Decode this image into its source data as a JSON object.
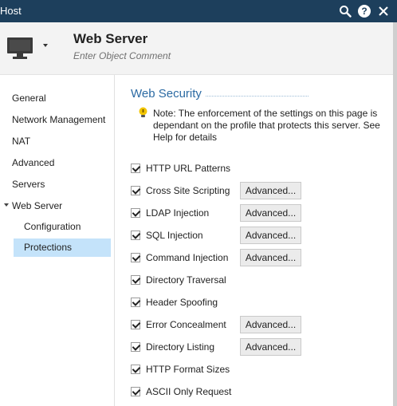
{
  "titlebar": {
    "title": "Host",
    "search_icon": "search-icon",
    "help_icon": "help-icon",
    "help_glyph": "?",
    "close_glyph": "✕"
  },
  "header": {
    "object_name": "Web Server",
    "comment_placeholder": "Enter Object Comment"
  },
  "sidebar": {
    "items": [
      {
        "label": "General"
      },
      {
        "label": "Network Management"
      },
      {
        "label": "NAT"
      },
      {
        "label": "Advanced"
      },
      {
        "label": "Servers"
      },
      {
        "label": "Web Server"
      },
      {
        "label": "Configuration"
      },
      {
        "label": "Protections"
      }
    ],
    "selected": "Protections",
    "expanded": "Web Server"
  },
  "main": {
    "section_title": "Web Security",
    "note": "Note: The enforcement of the settings on this page is dependant on the profile that protects this server. See Help for details",
    "advanced_label": "Advanced...",
    "protections": [
      {
        "label": "HTTP URL Patterns",
        "checked": true,
        "has_advanced": false
      },
      {
        "label": "Cross Site Scripting",
        "checked": true,
        "has_advanced": true
      },
      {
        "label": "LDAP Injection",
        "checked": true,
        "has_advanced": true
      },
      {
        "label": "SQL Injection",
        "checked": true,
        "has_advanced": true
      },
      {
        "label": "Command Injection",
        "checked": true,
        "has_advanced": true
      },
      {
        "label": "Directory Traversal",
        "checked": true,
        "has_advanced": false
      },
      {
        "label": "Header Spoofing",
        "checked": true,
        "has_advanced": false
      },
      {
        "label": "Error Concealment",
        "checked": true,
        "has_advanced": true
      },
      {
        "label": "Directory Listing",
        "checked": true,
        "has_advanced": true
      },
      {
        "label": "HTTP Format Sizes",
        "checked": true,
        "has_advanced": false
      },
      {
        "label": "ASCII Only Request",
        "checked": true,
        "has_advanced": false
      }
    ]
  },
  "colors": {
    "titlebar_bg": "#1d3f5c",
    "header_bg": "#f3f3f3",
    "selected_bg": "#c4e3fa",
    "section_title": "#2b6aa3",
    "note_icon": "#f2c500"
  }
}
